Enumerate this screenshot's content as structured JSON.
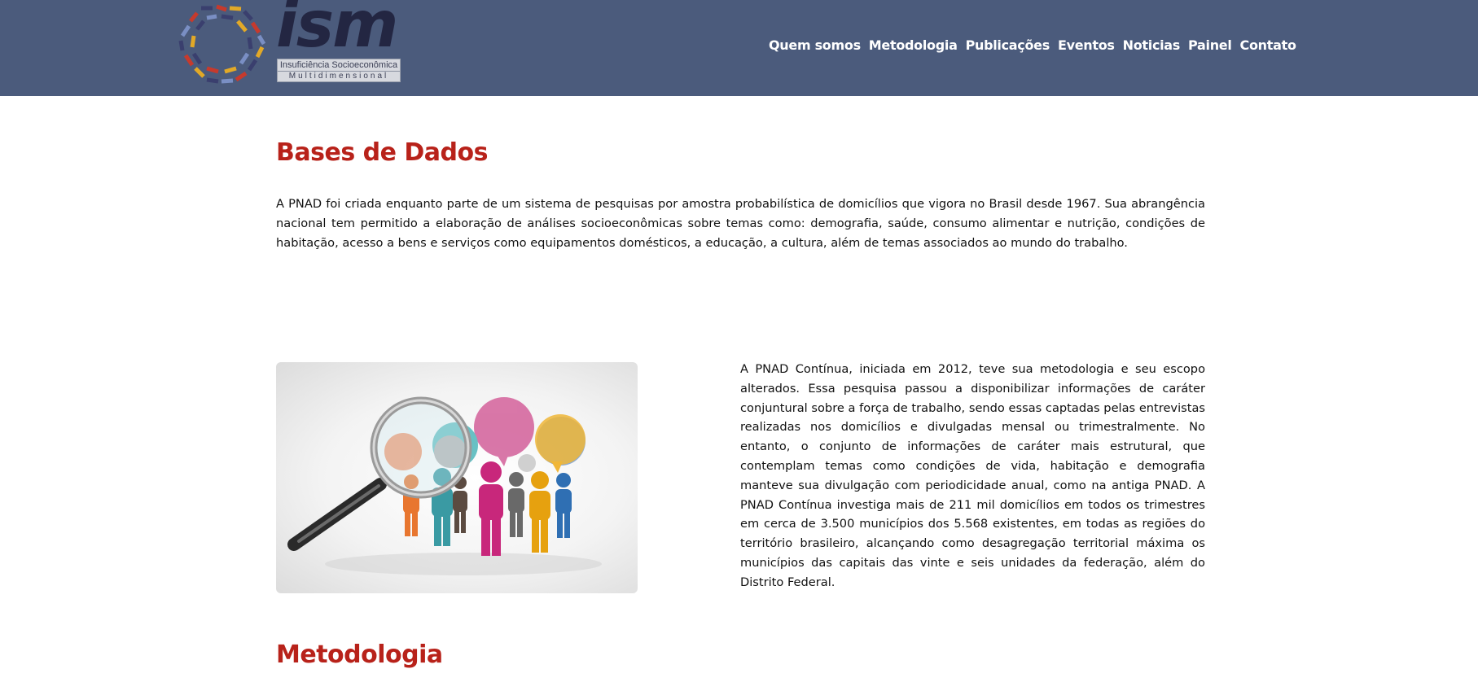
{
  "header": {
    "logo": {
      "wordmark": "ism",
      "tagline_line1": "Insuficiência Socioeconômica",
      "tagline_line2": "Multidimensional"
    },
    "nav": [
      {
        "label": "Quem somos"
      },
      {
        "label": "Metodologia"
      },
      {
        "label": "Publicações"
      },
      {
        "label": "Eventos"
      },
      {
        "label": "Noticias"
      },
      {
        "label": "Painel"
      },
      {
        "label": "Contato"
      }
    ]
  },
  "main": {
    "section_title": "Bases de Dados",
    "intro_paragraph": "A PNAD foi criada enquanto parte de um sistema de pesquisas por amostra probabilística de domicílios que vigora no Brasil desde 1967. Sua abrangência nacional tem permitido a elaboração de análises socioeconômicas sobre temas como: demografia, saúde, consumo alimentar e nutrição, condições de habitação, acesso a bens e serviços como equipamentos domésticos, a educação, a cultura, além de temas associados ao mundo do trabalho.",
    "pnad_continua_paragraph": "A PNAD Contínua, iniciada em 2012, teve sua metodologia e seu escopo alterados. Essa pesquisa passou a disponibilizar informações de caráter conjuntural sobre a força de trabalho, sendo essas captadas pelas entrevistas realizadas nos domicílios e divulgadas mensal ou trimestralmente. No entanto, o conjunto de informações de caráter mais estrutural, que contemplam temas como condições de vida, habitação e demografia manteve sua divulgação com periodicidade anual, como na antiga PNAD. A PNAD Contínua investiga mais de 211 mil domicílios em todos os trimestres em cerca de 3.500 municípios dos 5.568 existentes, em todas as regiões do território brasileiro, alcançando como desagregação territorial máxima os municípios das capitais das vinte e seis unidades da federação, além do Distrito Federal.",
    "next_section_title": "Metodologia"
  },
  "colors": {
    "header_bg": "#4b5b7c",
    "heading_red": "#b8221a",
    "logo_dark": "#232642"
  }
}
